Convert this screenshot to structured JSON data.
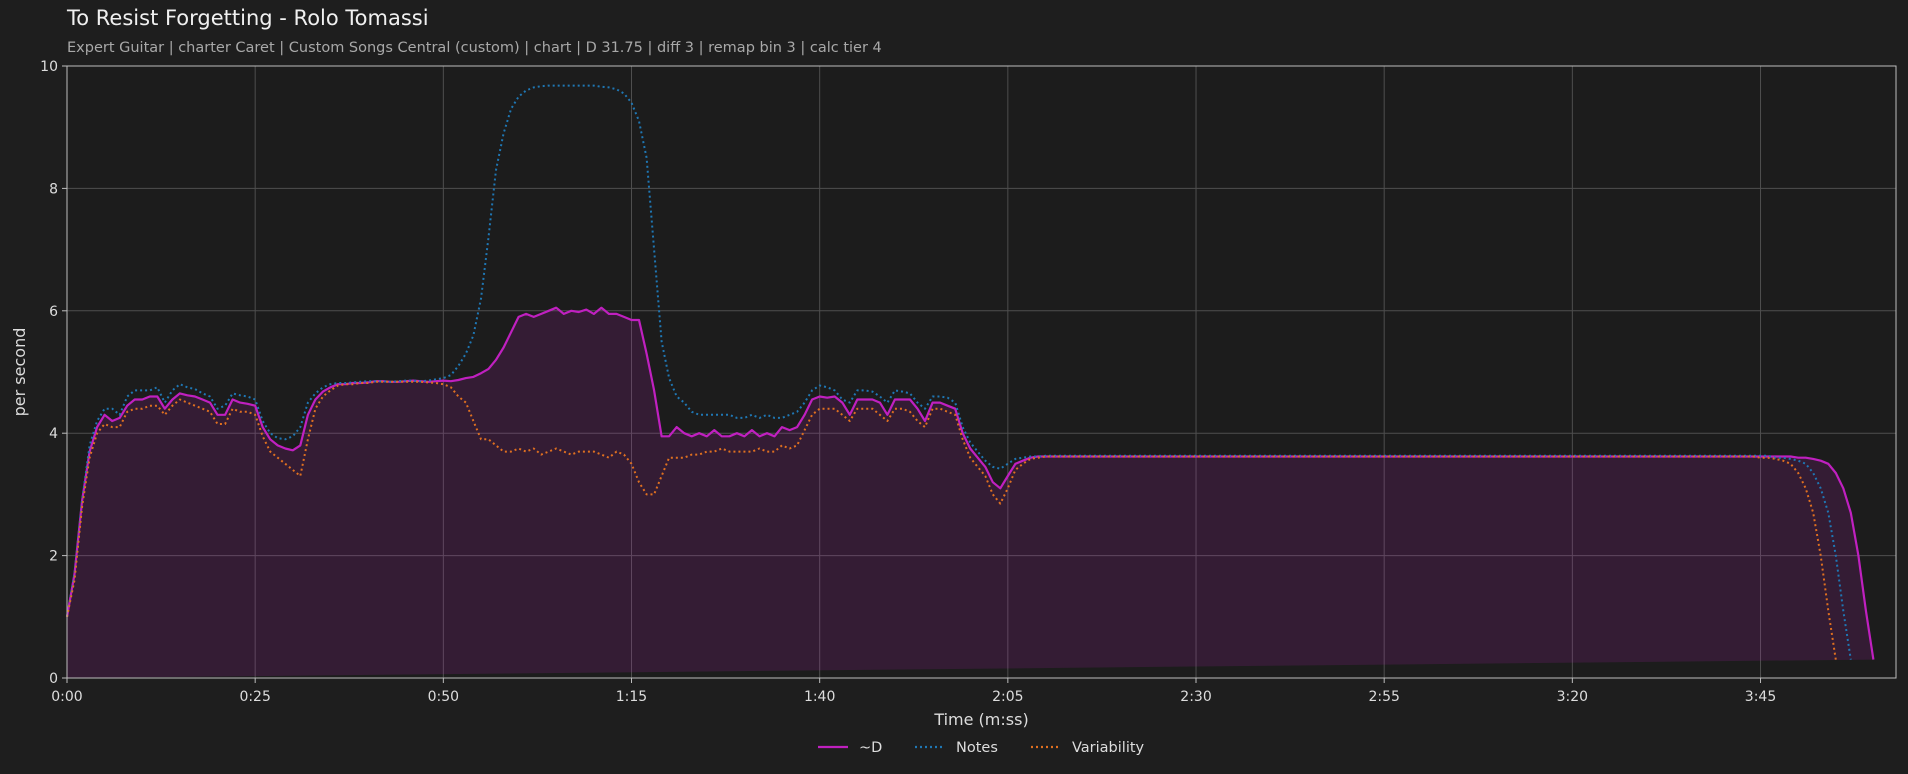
{
  "header": {
    "title": "To Resist Forgetting - Rolo Tomassi",
    "subtitle": "Expert Guitar  |  charter Caret  |  Custom Songs Central (custom)  |  chart  |  D 31.75  |  diff 3  |  remap bin 3  |  calc tier 4"
  },
  "chart_data": {
    "type": "line",
    "title": "To Resist Forgetting - Rolo Tomassi",
    "xlabel": "Time (m:ss)",
    "ylabel": "per second",
    "xlim": [
      0,
      243
    ],
    "ylim": [
      0,
      10
    ],
    "grid": true,
    "legend_position": "bottom-center",
    "x_ticks": [
      {
        "value": 0,
        "label": "0:00"
      },
      {
        "value": 25,
        "label": "0:25"
      },
      {
        "value": 50,
        "label": "0:50"
      },
      {
        "value": 75,
        "label": "1:15"
      },
      {
        "value": 100,
        "label": "1:40"
      },
      {
        "value": 125,
        "label": "2:05"
      },
      {
        "value": 150,
        "label": "2:30"
      },
      {
        "value": 175,
        "label": "2:55"
      },
      {
        "value": 200,
        "label": "3:20"
      },
      {
        "value": 225,
        "label": "3:45"
      }
    ],
    "y_ticks": [
      0,
      2,
      4,
      6,
      8,
      10
    ],
    "x": [
      0,
      1,
      2,
      3,
      4,
      5,
      6,
      7,
      8,
      9,
      10,
      11,
      12,
      13,
      14,
      15,
      16,
      17,
      18,
      19,
      20,
      21,
      22,
      23,
      24,
      25,
      26,
      27,
      28,
      29,
      30,
      31,
      32,
      33,
      34,
      35,
      36,
      37,
      38,
      39,
      40,
      41,
      42,
      43,
      44,
      45,
      46,
      47,
      48,
      49,
      50,
      51,
      52,
      53,
      54,
      55,
      56,
      57,
      58,
      59,
      60,
      61,
      62,
      63,
      64,
      65,
      66,
      67,
      68,
      69,
      70,
      71,
      72,
      73,
      74,
      75,
      76,
      77,
      78,
      79,
      80,
      81,
      82,
      83,
      84,
      85,
      86,
      87,
      88,
      89,
      90,
      91,
      92,
      93,
      94,
      95,
      96,
      97,
      98,
      99,
      100,
      101,
      102,
      103,
      104,
      105,
      106,
      107,
      108,
      109,
      110,
      111,
      112,
      113,
      114,
      115,
      116,
      117,
      118,
      119,
      120,
      121,
      122,
      123,
      124,
      125,
      126,
      127,
      128,
      129,
      130,
      131,
      132,
      133,
      134,
      135,
      136,
      137,
      138,
      139,
      140,
      141,
      142,
      143,
      144,
      145,
      146,
      147,
      148,
      149,
      150,
      151,
      152,
      153,
      154,
      155,
      156,
      157,
      158,
      159,
      160,
      161,
      162,
      163,
      164,
      165,
      166,
      167,
      168,
      169,
      170,
      171,
      172,
      173,
      174,
      175,
      176,
      177,
      178,
      179,
      180,
      181,
      182,
      183,
      184,
      185,
      186,
      187,
      188,
      189,
      190,
      191,
      192,
      193,
      194,
      195,
      196,
      197,
      198,
      199,
      200,
      201,
      202,
      203,
      204,
      205,
      206,
      207,
      208,
      209,
      210,
      211,
      212,
      213,
      214,
      215,
      216,
      217,
      218,
      219,
      220,
      221,
      222,
      223,
      224,
      225,
      226,
      227,
      228,
      229,
      230,
      231,
      232,
      233,
      234,
      235,
      236,
      237,
      238,
      239,
      240,
      241,
      242,
      243
    ],
    "series": [
      {
        "name": "~D",
        "color": "#c020c0",
        "style": "solid",
        "filled": true,
        "values": [
          1.0,
          1.7,
          2.9,
          3.7,
          4.1,
          4.3,
          4.2,
          4.25,
          4.45,
          4.55,
          4.55,
          4.6,
          4.6,
          4.4,
          4.55,
          4.65,
          4.62,
          4.6,
          4.55,
          4.5,
          4.3,
          4.3,
          4.55,
          4.5,
          4.48,
          4.45,
          4.1,
          3.9,
          3.8,
          3.75,
          3.72,
          3.8,
          4.3,
          4.55,
          4.68,
          4.75,
          4.8,
          4.8,
          4.82,
          4.82,
          4.83,
          4.85,
          4.85,
          4.84,
          4.84,
          4.85,
          4.86,
          4.85,
          4.84,
          4.85,
          4.86,
          4.85,
          4.87,
          4.9,
          4.92,
          4.98,
          5.05,
          5.2,
          5.4,
          5.65,
          5.9,
          5.95,
          5.9,
          5.95,
          6.0,
          6.05,
          5.95,
          6.0,
          5.98,
          6.02,
          5.95,
          6.05,
          5.95,
          5.95,
          5.9,
          5.85,
          5.85,
          5.3,
          4.7,
          3.95,
          3.95,
          4.1,
          4.0,
          3.95,
          4.0,
          3.95,
          4.05,
          3.95,
          3.95,
          4.0,
          3.95,
          4.05,
          3.95,
          4.0,
          3.95,
          4.1,
          4.05,
          4.1,
          4.3,
          4.55,
          4.6,
          4.58,
          4.6,
          4.5,
          4.3,
          4.55,
          4.55,
          4.55,
          4.5,
          4.3,
          4.55,
          4.55,
          4.55,
          4.4,
          4.2,
          4.5,
          4.5,
          4.45,
          4.4,
          4.0,
          3.75,
          3.6,
          3.45,
          3.2,
          3.1,
          3.3,
          3.5,
          3.55,
          3.6,
          3.62,
          3.62,
          3.62,
          3.62,
          3.62,
          3.62,
          3.62,
          3.62,
          3.62,
          3.62,
          3.62,
          3.62,
          3.62,
          3.62,
          3.62,
          3.62,
          3.62,
          3.62,
          3.62,
          3.62,
          3.62,
          3.62,
          3.62,
          3.62,
          3.62,
          3.62,
          3.62,
          3.62,
          3.62,
          3.62,
          3.62,
          3.62,
          3.62,
          3.62,
          3.62,
          3.62,
          3.62,
          3.62,
          3.62,
          3.62,
          3.62,
          3.62,
          3.62,
          3.62,
          3.62,
          3.62,
          3.62,
          3.62,
          3.62,
          3.62,
          3.62,
          3.62,
          3.62,
          3.62,
          3.62,
          3.62,
          3.62,
          3.62,
          3.62,
          3.62,
          3.62,
          3.62,
          3.62,
          3.62,
          3.62,
          3.62,
          3.62,
          3.62,
          3.62,
          3.62,
          3.62,
          3.62,
          3.62,
          3.62,
          3.62,
          3.62,
          3.62,
          3.62,
          3.62,
          3.62,
          3.62,
          3.62,
          3.62,
          3.62,
          3.62,
          3.62,
          3.62,
          3.62,
          3.62,
          3.62,
          3.62,
          3.62,
          3.62,
          3.62,
          3.62,
          3.62,
          3.62,
          3.62,
          3.62,
          3.62,
          3.62,
          3.6,
          3.6,
          3.58,
          3.55,
          3.5,
          3.35,
          3.1,
          2.7,
          2.0,
          1.1,
          0.3
        ]
      },
      {
        "name": "Notes",
        "color": "#1f77b4",
        "style": "dotted",
        "values": [
          1.0,
          1.7,
          2.9,
          3.8,
          4.2,
          4.4,
          4.4,
          4.3,
          4.6,
          4.7,
          4.7,
          4.7,
          4.75,
          4.5,
          4.7,
          4.8,
          4.75,
          4.72,
          4.65,
          4.6,
          4.4,
          4.45,
          4.65,
          4.62,
          4.6,
          4.55,
          4.2,
          4.0,
          3.92,
          3.9,
          3.95,
          4.1,
          4.5,
          4.65,
          4.75,
          4.8,
          4.82,
          4.82,
          4.83,
          4.84,
          4.85,
          4.85,
          4.85,
          4.84,
          4.85,
          4.86,
          4.86,
          4.85,
          4.86,
          4.88,
          4.9,
          4.95,
          5.1,
          5.3,
          5.6,
          6.2,
          7.2,
          8.3,
          8.9,
          9.3,
          9.5,
          9.6,
          9.65,
          9.67,
          9.68,
          9.68,
          9.68,
          9.68,
          9.68,
          9.68,
          9.68,
          9.66,
          9.65,
          9.62,
          9.55,
          9.4,
          9.1,
          8.5,
          7.0,
          5.5,
          4.9,
          4.6,
          4.5,
          4.35,
          4.3,
          4.3,
          4.3,
          4.3,
          4.3,
          4.25,
          4.25,
          4.3,
          4.25,
          4.3,
          4.25,
          4.25,
          4.3,
          4.35,
          4.5,
          4.7,
          4.78,
          4.75,
          4.7,
          4.55,
          4.5,
          4.7,
          4.7,
          4.68,
          4.6,
          4.5,
          4.7,
          4.68,
          4.65,
          4.5,
          4.4,
          4.6,
          4.6,
          4.58,
          4.5,
          4.1,
          3.85,
          3.7,
          3.55,
          3.45,
          3.42,
          3.5,
          3.58,
          3.6,
          3.62,
          3.62,
          3.63,
          3.63,
          3.63,
          3.63,
          3.63,
          3.63,
          3.63,
          3.63,
          3.63,
          3.63,
          3.63,
          3.63,
          3.63,
          3.63,
          3.63,
          3.63,
          3.63,
          3.63,
          3.63,
          3.63,
          3.63,
          3.63,
          3.63,
          3.63,
          3.63,
          3.63,
          3.63,
          3.63,
          3.63,
          3.63,
          3.63,
          3.63,
          3.63,
          3.63,
          3.63,
          3.63,
          3.63,
          3.63,
          3.63,
          3.63,
          3.63,
          3.63,
          3.63,
          3.63,
          3.63,
          3.63,
          3.63,
          3.63,
          3.63,
          3.63,
          3.63,
          3.63,
          3.63,
          3.63,
          3.63,
          3.63,
          3.63,
          3.63,
          3.63,
          3.63,
          3.63,
          3.63,
          3.63,
          3.63,
          3.63,
          3.63,
          3.63,
          3.63,
          3.63,
          3.63,
          3.63,
          3.63,
          3.63,
          3.63,
          3.63,
          3.63,
          3.63,
          3.63,
          3.63,
          3.63,
          3.63,
          3.63,
          3.63,
          3.63,
          3.63,
          3.63,
          3.63,
          3.63,
          3.63,
          3.63,
          3.63,
          3.63,
          3.63,
          3.63,
          3.63,
          3.63,
          3.63,
          3.6,
          3.6,
          3.58,
          3.55,
          3.5,
          3.35,
          3.1,
          2.7,
          2.0,
          1.1,
          0.3
        ]
      },
      {
        "name": "Variability",
        "color": "#e07020",
        "style": "dotted",
        "values": [
          1.0,
          1.6,
          2.8,
          3.6,
          4.0,
          4.15,
          4.1,
          4.1,
          4.35,
          4.4,
          4.4,
          4.45,
          4.45,
          4.3,
          4.45,
          4.55,
          4.5,
          4.45,
          4.4,
          4.35,
          4.15,
          4.15,
          4.4,
          4.35,
          4.35,
          4.3,
          3.95,
          3.7,
          3.6,
          3.5,
          3.4,
          3.3,
          3.9,
          4.4,
          4.6,
          4.7,
          4.78,
          4.8,
          4.8,
          4.82,
          4.82,
          4.84,
          4.84,
          4.84,
          4.84,
          4.84,
          4.84,
          4.84,
          4.83,
          4.82,
          4.8,
          4.75,
          4.6,
          4.5,
          4.2,
          3.9,
          3.9,
          3.8,
          3.7,
          3.7,
          3.75,
          3.7,
          3.75,
          3.65,
          3.7,
          3.75,
          3.7,
          3.65,
          3.7,
          3.7,
          3.7,
          3.65,
          3.6,
          3.7,
          3.65,
          3.5,
          3.2,
          3.0,
          3.0,
          3.3,
          3.6,
          3.6,
          3.6,
          3.65,
          3.65,
          3.7,
          3.7,
          3.75,
          3.7,
          3.7,
          3.7,
          3.7,
          3.75,
          3.7,
          3.7,
          3.8,
          3.75,
          3.8,
          4.05,
          4.3,
          4.4,
          4.4,
          4.4,
          4.3,
          4.2,
          4.4,
          4.4,
          4.4,
          4.3,
          4.2,
          4.4,
          4.4,
          4.35,
          4.2,
          4.1,
          4.4,
          4.4,
          4.35,
          4.3,
          3.9,
          3.6,
          3.45,
          3.3,
          3.0,
          2.85,
          3.1,
          3.4,
          3.5,
          3.58,
          3.6,
          3.62,
          3.62,
          3.62,
          3.62,
          3.62,
          3.62,
          3.62,
          3.62,
          3.62,
          3.62,
          3.62,
          3.62,
          3.62,
          3.62,
          3.62,
          3.62,
          3.62,
          3.62,
          3.62,
          3.62,
          3.62,
          3.62,
          3.62,
          3.62,
          3.62,
          3.62,
          3.62,
          3.62,
          3.62,
          3.62,
          3.62,
          3.62,
          3.62,
          3.62,
          3.62,
          3.62,
          3.62,
          3.62,
          3.62,
          3.62,
          3.62,
          3.62,
          3.62,
          3.62,
          3.62,
          3.62,
          3.62,
          3.62,
          3.62,
          3.62,
          3.62,
          3.62,
          3.62,
          3.62,
          3.62,
          3.62,
          3.62,
          3.62,
          3.62,
          3.62,
          3.62,
          3.62,
          3.62,
          3.62,
          3.62,
          3.62,
          3.62,
          3.62,
          3.62,
          3.62,
          3.62,
          3.62,
          3.62,
          3.62,
          3.62,
          3.62,
          3.62,
          3.62,
          3.62,
          3.62,
          3.62,
          3.62,
          3.62,
          3.62,
          3.62,
          3.62,
          3.62,
          3.62,
          3.62,
          3.62,
          3.62,
          3.62,
          3.62,
          3.62,
          3.62,
          3.6,
          3.6,
          3.58,
          3.55,
          3.5,
          3.35,
          3.1,
          2.7,
          2.0,
          1.1,
          0.3
        ]
      }
    ]
  }
}
